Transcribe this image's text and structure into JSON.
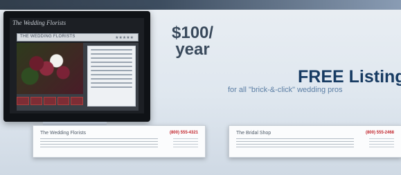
{
  "monitor": {
    "logo": "The Wedding Florists",
    "header_title": "THE WEDDING FLORISTS",
    "stars": "★★★★★"
  },
  "pricing": {
    "price_line1": "$100/",
    "price_line2": "year"
  },
  "promo": {
    "title": "FREE Listing",
    "subtitle": "for all \"brick-&-click\" wedding pros"
  },
  "listings": [
    {
      "name": "The Wedding Florists",
      "phone": "(800) 555-4321"
    },
    {
      "name": "The Bridal Shop",
      "phone": "(800) 555-2468"
    }
  ]
}
